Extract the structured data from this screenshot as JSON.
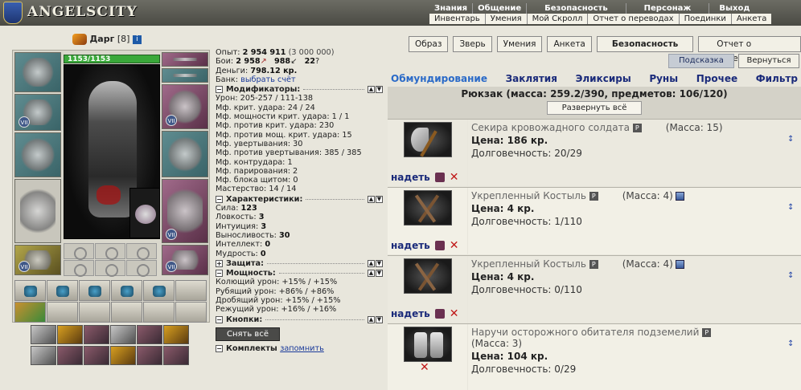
{
  "nav": {
    "logo": "ANGELSCITY",
    "top": [
      "Знания",
      "Общение",
      "Безопасность",
      "Персонаж",
      "Выход"
    ],
    "sub": [
      "Инвентарь",
      "Умения",
      "Мой Скролл",
      "Отчет о переводах",
      "Поединки",
      "Анкета"
    ]
  },
  "character": {
    "name": "Дарг",
    "level": "[8]",
    "info_badge": "i",
    "hp": "1153/1153",
    "slot_level_marks": "VII"
  },
  "stats": {
    "exp_label": "Опыт:",
    "exp_value": "2 954 911",
    "exp_next": "(3 000 000)",
    "fights_label": "Бои:",
    "fights_wins": "2 958",
    "fights_losses": "988",
    "fights_draws": "22",
    "money_label": "Деньги:",
    "money_value": "798.12 кр.",
    "bank_label": "Банк:",
    "bank_link": "выбрать счёт",
    "modifiers_title": "Модификаторы:",
    "modifiers": [
      "Урон: 205-257 / 111-138",
      "Мф. крит. удара: 24 / 24",
      "Мф. мощности крит. удара: 1 / 1",
      "Мф. против крит. удара: 230",
      "Мф. против мощ. крит. удара: 15",
      "Мф. увертывания: 30",
      "Мф. против увертывания: 385 / 385",
      "Мф. контрудара: 1",
      "Мф. парирования: 2",
      "Мф. блока щитом: 0",
      "Мастерство: 14 / 14"
    ],
    "characteristics_title": "Характеристики:",
    "characteristics": [
      {
        "label": "Сила: ",
        "value": "123"
      },
      {
        "label": "Ловкость: ",
        "value": "3"
      },
      {
        "label": "Интуиция: ",
        "value": "3"
      },
      {
        "label": "Выносливость: ",
        "value": "30"
      },
      {
        "label": "Интеллект: ",
        "value": "0"
      },
      {
        "label": "Мудрость: ",
        "value": "0"
      }
    ],
    "defense_title": "Защита:",
    "power_title": "Мощность:",
    "power": [
      "Колющий урон: +15% / +15%",
      "Рубящий урон: +86% / +86%",
      "Дробящий урон: +15% / +15%",
      "Режущий урон: +16% / +16%"
    ],
    "buttons_title": "Кнопки:",
    "strip_all": "Снять всё",
    "sets_title": "Комплекты",
    "remember": "запомнить"
  },
  "toolbar": {
    "buttons": [
      "Образ",
      "Зверь",
      "Умения",
      "Анкета"
    ],
    "security": "Безопасность",
    "transfers": "Отчет о переводах",
    "help": "Подсказка",
    "back": "Вернуться"
  },
  "tabs": [
    "Обмундирование",
    "Заклятия",
    "Эликсиры",
    "Руны",
    "Прочее",
    "Фильтр"
  ],
  "inventory": {
    "title": "Рюкзак (масса: 259.2/390, предметов: 106/120)",
    "expand": "Развернуть всё",
    "wear": "надеть",
    "items": [
      {
        "name": "Секира кровожадного солдата",
        "mass": "(Масса: 15)",
        "price": "Цена: 186 кр.",
        "durability": "Долговечность: 20/29",
        "r_badge": "P"
      },
      {
        "name": "Укрепленный Костыль",
        "mass": "(Масса: 4)",
        "price": "Цена: 4 кр.",
        "durability": "Долговечность: 1/110",
        "r_badge": "P"
      },
      {
        "name": "Укрепленный Костыль",
        "mass": "(Масса: 4)",
        "price": "Цена: 4 кр.",
        "durability": "Долговечность: 0/110",
        "r_badge": "P"
      },
      {
        "name": "Наручи осторожного обитателя подземелий",
        "mass": "(Масса: 3)",
        "price": "Цена: 104 кр.",
        "durability": "Долговечность: 0/29",
        "r_badge": "P"
      }
    ]
  }
}
